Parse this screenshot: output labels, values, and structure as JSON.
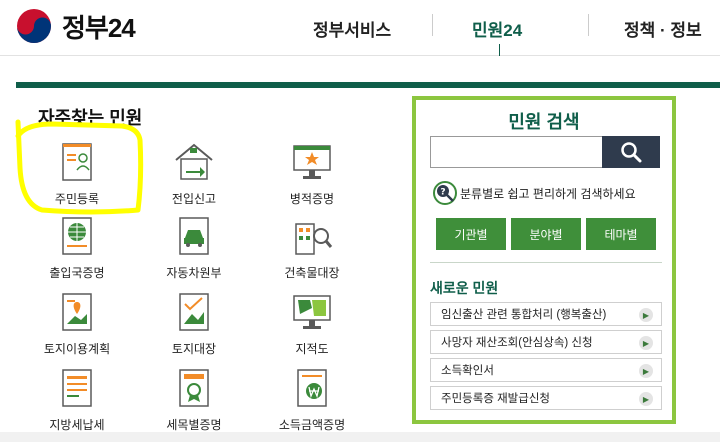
{
  "header": {
    "logo_text": "정부24",
    "nav": [
      "정부서비스",
      "민원24",
      "정책 · 정보"
    ],
    "active_nav": "민원24"
  },
  "frequent": {
    "title": "자주찾는 민원",
    "items": [
      {
        "label": "주민등록",
        "icon": "resident-registration-icon"
      },
      {
        "label": "전입신고",
        "icon": "move-in-house-icon"
      },
      {
        "label": "병적증명",
        "icon": "military-record-icon"
      },
      {
        "label": "출입국증명",
        "icon": "immigration-globe-icon"
      },
      {
        "label": "자동차원부",
        "icon": "car-registry-icon"
      },
      {
        "label": "건축물대장",
        "icon": "building-registry-icon"
      },
      {
        "label": "토지이용계획",
        "icon": "land-use-plan-icon"
      },
      {
        "label": "토지대장",
        "icon": "land-registry-icon"
      },
      {
        "label": "지적도",
        "icon": "cadastral-map-icon"
      },
      {
        "label": "지방세납세",
        "icon": "local-tax-icon"
      },
      {
        "label": "세목별증명",
        "icon": "tax-item-certificate-icon"
      },
      {
        "label": "소득금액증명",
        "icon": "income-certificate-icon"
      }
    ]
  },
  "search_panel": {
    "title": "민원 검색",
    "input_value": "",
    "help_text": "분류별로 쉽고 편리하게 검색하세요",
    "category_buttons": [
      "기관별",
      "분야별",
      "테마별"
    ],
    "new_title": "새로운 민원",
    "new_items": [
      "임신출산 관련 통합처리 (행복출산)",
      "사망자 재산조회(안심상속) 신청",
      "소득확인서",
      "주민등록증 재발급신청"
    ]
  },
  "colors": {
    "primary_green": "#0f5e4a",
    "accent_green": "#8cc63f",
    "button_green": "#3f8f3a",
    "search_button": "#2f3b4d",
    "highlight": "#ffff00"
  }
}
